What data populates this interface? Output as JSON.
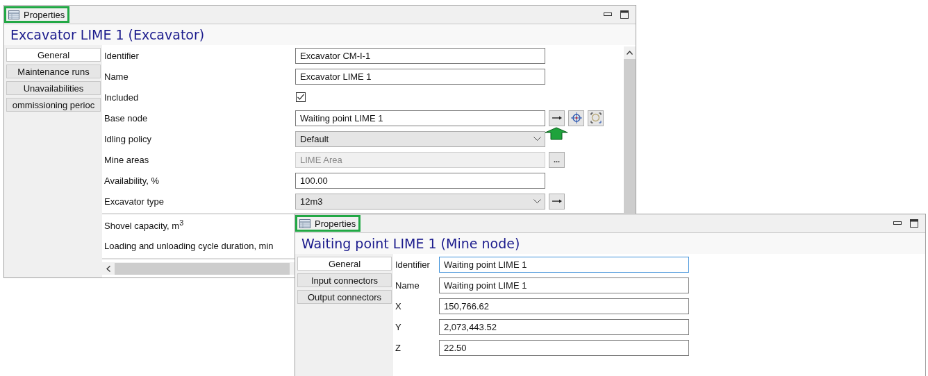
{
  "panels": [
    {
      "header": {
        "label": "Properties",
        "highlighted": true
      },
      "title": "Excavator LIME 1 (Excavator)",
      "scrollbars": true,
      "nav": [
        {
          "label": "General",
          "selected": true
        },
        {
          "label": "Maintenance runs",
          "selected": false
        },
        {
          "label": "Unavailabilities",
          "selected": false
        },
        {
          "label": "ommissioning perioc",
          "selected": false
        }
      ],
      "rows": [
        {
          "label": "Identifier",
          "kind": "text",
          "value": "Excavator CM-I-1",
          "disabled": false,
          "focused": false
        },
        {
          "label": "Name",
          "kind": "text",
          "value": "Excavator LIME 1",
          "disabled": false,
          "focused": false
        },
        {
          "label": "Included",
          "kind": "checkbox",
          "checked": true
        },
        {
          "label": "Base node",
          "kind": "text",
          "value": "Waiting point LIME 1",
          "disabled": false,
          "focused": false,
          "callout": true,
          "buttons": [
            {
              "kind": "arrow"
            },
            {
              "kind": "locate"
            },
            {
              "kind": "zoom"
            }
          ]
        },
        {
          "label": "Idling policy",
          "kind": "dropdown",
          "value": "Default"
        },
        {
          "label": "Mine areas",
          "kind": "text",
          "value": "LIME Area",
          "disabled": true,
          "focused": false,
          "buttons": [
            {
              "kind": "ellipsis",
              "text": "..."
            }
          ]
        },
        {
          "label": "Availability, %",
          "kind": "text",
          "value": "100.00",
          "disabled": false,
          "focused": false
        },
        {
          "label": "Excavator type",
          "kind": "dropdown",
          "value": "12m3",
          "buttons": [
            {
              "kind": "arrow"
            }
          ]
        }
      ],
      "lower_rows": [
        {
          "label": "Shovel capacity, m$^{3}$"
        },
        {
          "label": "Loading and unloading cycle duration, min"
        }
      ]
    },
    {
      "header": {
        "label": "Properties",
        "highlighted": true
      },
      "title": "Waiting point LIME 1 (Mine node)",
      "scrollbars": false,
      "nav": [
        {
          "label": "General",
          "selected": true
        },
        {
          "label": "Input connectors",
          "selected": false
        },
        {
          "label": "Output connectors",
          "selected": false
        }
      ],
      "rows": [
        {
          "label": "Identifier",
          "kind": "text",
          "value": "Waiting point LIME 1",
          "disabled": false,
          "focused": true
        },
        {
          "label": "Name",
          "kind": "text",
          "value": "Waiting point LIME 1",
          "disabled": false,
          "focused": false
        },
        {
          "label": "X",
          "kind": "text",
          "value": "150,766.62",
          "disabled": false,
          "focused": false
        },
        {
          "label": "Y",
          "kind": "text",
          "value": "2,073,443.52",
          "disabled": false,
          "focused": false
        },
        {
          "label": "Z",
          "kind": "text",
          "value": "22.50",
          "disabled": false,
          "focused": false
        }
      ]
    }
  ]
}
